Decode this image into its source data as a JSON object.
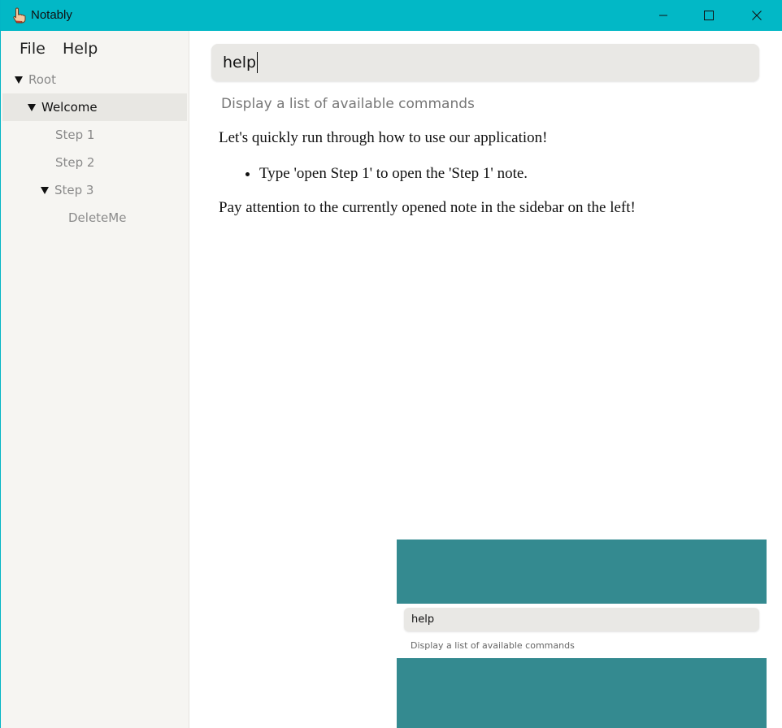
{
  "window": {
    "title": "Notably",
    "icon": "pointing-hand-icon",
    "accent_color": "#02b8c6"
  },
  "menu": {
    "file": "File",
    "help": "Help"
  },
  "tree": {
    "items": [
      {
        "label": "Root",
        "expanded": true
      },
      {
        "label": "Welcome",
        "expanded": true,
        "selected": true
      },
      {
        "label": "Step 1"
      },
      {
        "label": "Step 2"
      },
      {
        "label": "Step 3",
        "expanded": true
      },
      {
        "label": "DeleteMe"
      }
    ]
  },
  "command": {
    "value": "help",
    "suggestion": "Display a list of available commands"
  },
  "note": {
    "intro": "Let's quickly run through how to use our application!",
    "bullets": [
      "Type 'open Step 1' to open the 'Step 1' note."
    ],
    "outro": "Pay attention to the currently opened note in the sidebar on the left!"
  },
  "preview": {
    "command_value": "help",
    "suggestion": "Display a list of available commands",
    "band_color": "#348a90"
  }
}
